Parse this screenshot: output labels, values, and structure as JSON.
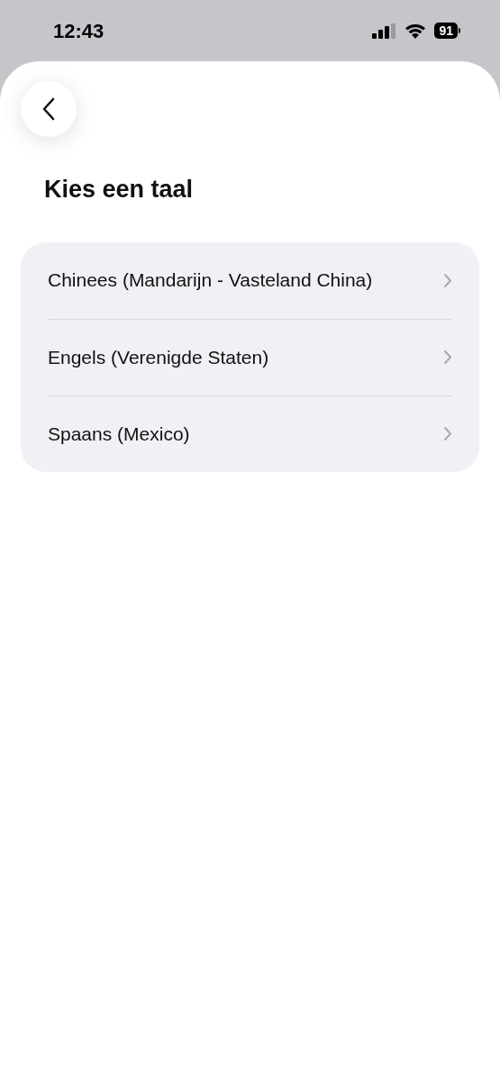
{
  "status_bar": {
    "time": "12:43",
    "battery": "91"
  },
  "title": "Kies een taal",
  "languages": [
    {
      "label": "Chinees (Mandarijn - Vasteland China)"
    },
    {
      "label": "Engels (Verenigde Staten)"
    },
    {
      "label": "Spaans (Mexico)"
    }
  ]
}
